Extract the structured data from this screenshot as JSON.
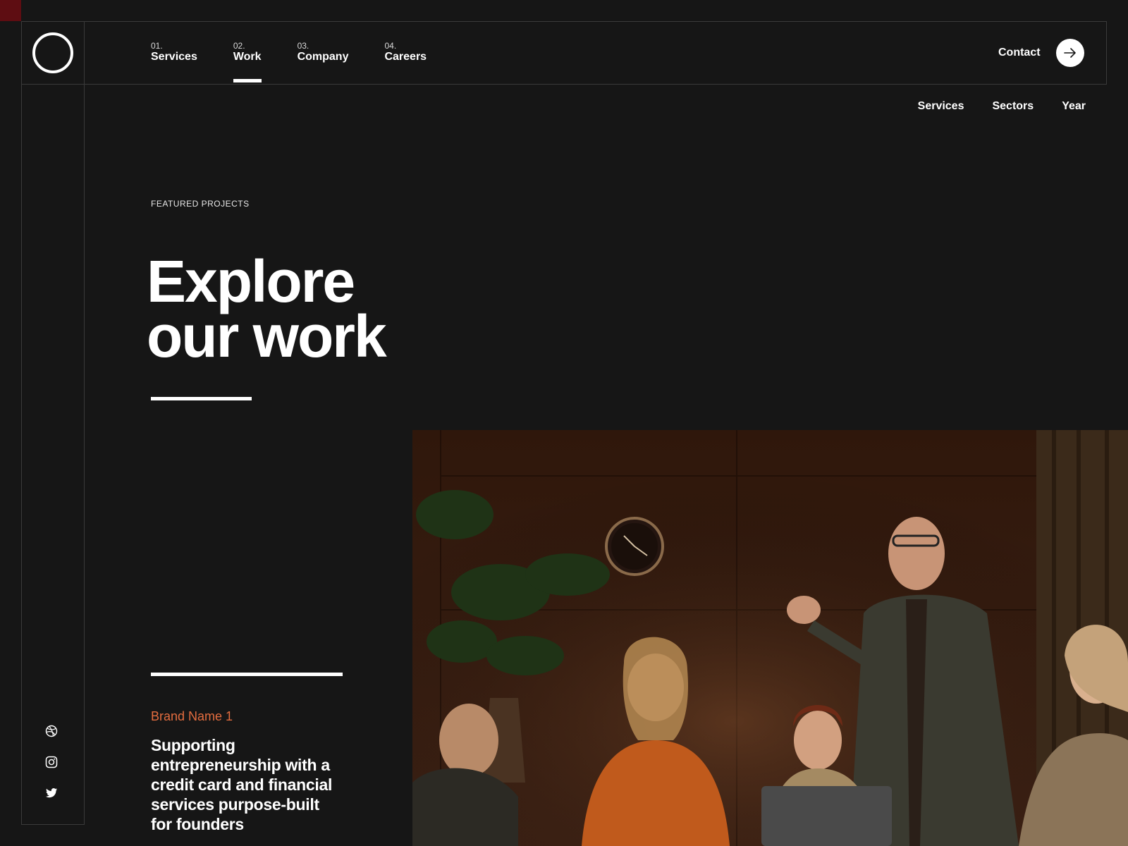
{
  "nav": {
    "items": [
      {
        "num": "01.",
        "label": "Services",
        "active": false
      },
      {
        "num": "02.",
        "label": "Work",
        "active": true
      },
      {
        "num": "03.",
        "label": "Company",
        "active": false
      },
      {
        "num": "04.",
        "label": "Careers",
        "active": false
      }
    ],
    "contact_label": "Contact"
  },
  "filters": [
    "Services",
    "Sectors",
    "Year"
  ],
  "hero": {
    "eyebrow": "FEATURED PROJECTS",
    "title_line1": "Explore",
    "title_line2": "our work"
  },
  "project": {
    "brand": "Brand Name 1",
    "description": "Supporting entrepreneurship with a credit card and financial services purpose-built for founders"
  },
  "colors": {
    "background": "#161616",
    "accent": "#e46d3f",
    "corner": "#5e0d12"
  },
  "icons": {
    "contact": "arrow-right-icon",
    "socials": [
      "dribbble-icon",
      "instagram-icon",
      "twitter-icon"
    ]
  }
}
